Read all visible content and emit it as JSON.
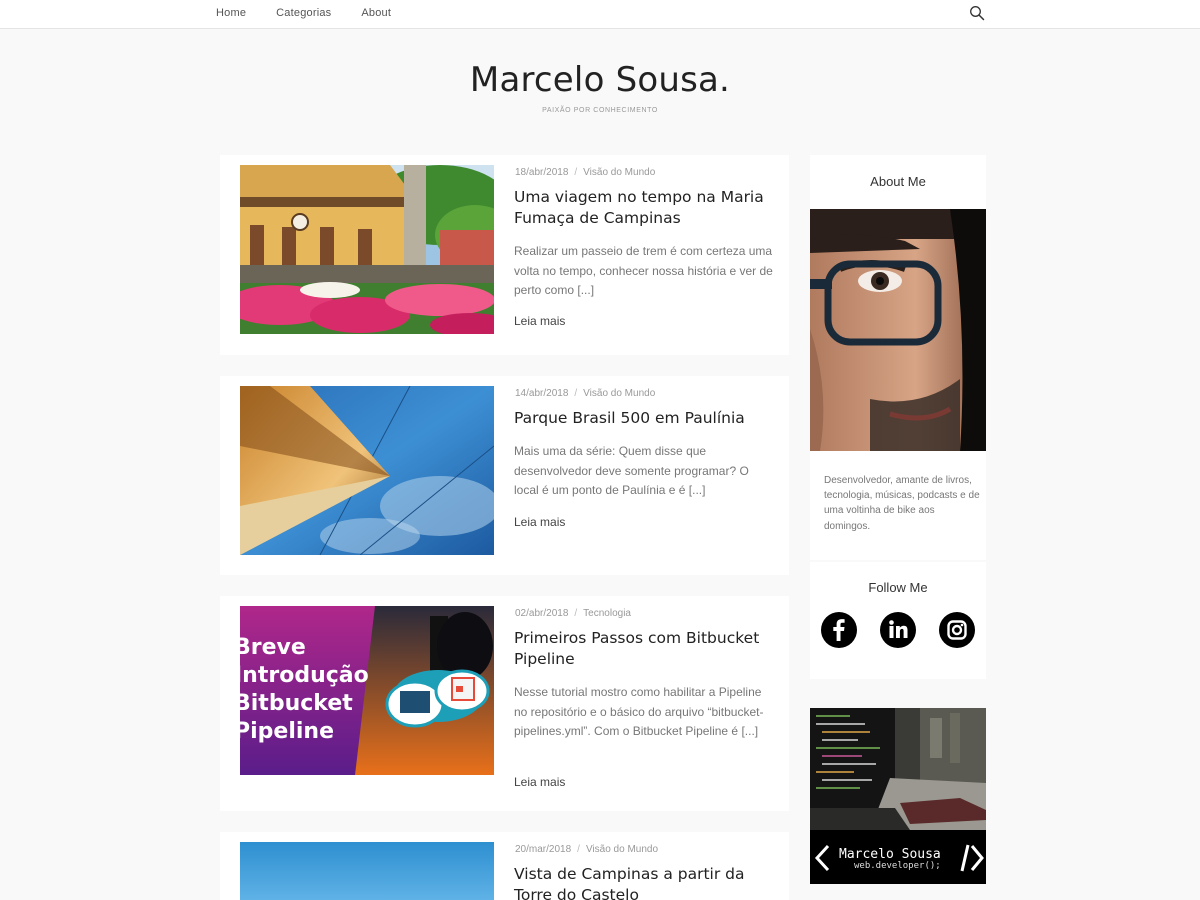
{
  "nav": {
    "items": [
      "Home",
      "Categorias",
      "About"
    ],
    "search_icon": "search-icon"
  },
  "site": {
    "title": "Marcelo Sousa.",
    "tagline": "PAIXÃO POR CONHECIMENTO"
  },
  "posts": [
    {
      "date": "18/abr/2018",
      "category": "Visão do Mundo",
      "title": "Uma viagem no tempo na Maria Fumaça de Campinas",
      "excerpt": "Realizar um passeio de trem é com certeza uma volta no tempo, conhecer nossa história e ver de perto como [...]",
      "more": "Leia mais"
    },
    {
      "date": "14/abr/2018",
      "category": "Visão do Mundo",
      "title": "Parque Brasil 500 em Paulínia",
      "excerpt": "Mais uma da série: Quem disse que desenvolvedor deve somente programar? O local é um ponto de Paulínia e é [...]",
      "more": "Leia mais"
    },
    {
      "date": "02/abr/2018",
      "category": "Tecnologia",
      "title": "Primeiros Passos com Bitbucket Pipeline",
      "excerpt": "Nesse tutorial mostro como habilitar a Pipeline no repositório e o básico do arquivo “bitbucket-pipelines.yml”. Com o Bitbucket Pipeline é [...]",
      "more": "Leia mais",
      "thumb_text": [
        "Breve",
        "Introdução",
        "Bitbucket",
        "Pipeline"
      ]
    },
    {
      "date": "20/mar/2018",
      "category": "Visão do Mundo",
      "title": "Vista de Campinas a partir da Torre do Castelo"
    }
  ],
  "sidebar": {
    "about_title": "About Me",
    "about_text": "Desenvolvedor, amante de livros, tecnologia, músicas, podcasts e de uma voltinha de bike aos domingos.",
    "follow_title": "Follow Me",
    "social": [
      "facebook-icon",
      "linkedin-icon",
      "instagram-icon"
    ],
    "promo_name": "Marcelo Sousa",
    "promo_sub": "web.developer();"
  },
  "colors": {
    "background": "#f9f9f9",
    "card": "#ffffff",
    "text": "#222222",
    "muted": "#999999"
  }
}
